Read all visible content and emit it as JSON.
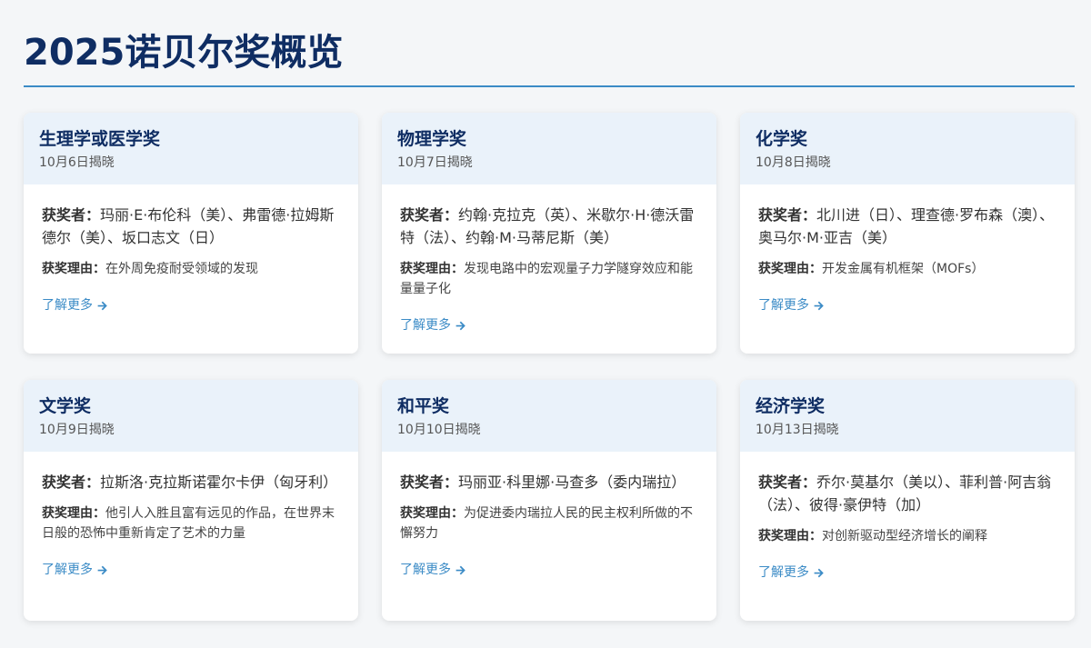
{
  "page": {
    "title": "2025诺贝尔奖概览"
  },
  "labels": {
    "winners": "获奖者：",
    "reason": "获奖理由：",
    "more": "了解更多"
  },
  "cards": [
    {
      "title": "生理学或医学奖",
      "date": "10月6日揭晓",
      "winners": "玛丽·E·布伦科（美）、弗雷德·拉姆斯德尔（美）、坂口志文（日）",
      "reason": "在外周免疫耐受领域的发现"
    },
    {
      "title": "物理学奖",
      "date": "10月7日揭晓",
      "winners": "约翰·克拉克（英）、米歇尔·H·德沃雷特（法）、约翰·M·马蒂尼斯（美）",
      "reason": "发现电路中的宏观量子力学隧穿效应和能量量子化"
    },
    {
      "title": "化学奖",
      "date": "10月8日揭晓",
      "winners": "北川进（日）、理查德·罗布森（澳）、奥马尔·M·亚吉（美）",
      "reason": "开发金属有机框架（MOFs）"
    },
    {
      "title": "文学奖",
      "date": "10月9日揭晓",
      "winners": "拉斯洛·克拉斯诺霍尔卡伊（匈牙利）",
      "reason": "他引人入胜且富有远见的作品，在世界末日般的恐怖中重新肯定了艺术的力量"
    },
    {
      "title": "和平奖",
      "date": "10月10日揭晓",
      "winners": "玛丽亚·科里娜·马查多（委内瑞拉）",
      "reason": "为促进委内瑞拉人民的民主权利所做的不懈努力"
    },
    {
      "title": "经济学奖",
      "date": "10月13日揭晓",
      "winners": "乔尔·莫基尔（美以）、菲利普·阿吉翁（法）、彼得·豪伊特（加）",
      "reason": "对创新驱动型经济增长的阐释"
    }
  ],
  "colors": {
    "title": "#0f2d63",
    "accent": "#3b8bc6",
    "card_head_bg": "#eaf2fa"
  },
  "icons": {
    "more_link": "arrow-right-icon"
  }
}
